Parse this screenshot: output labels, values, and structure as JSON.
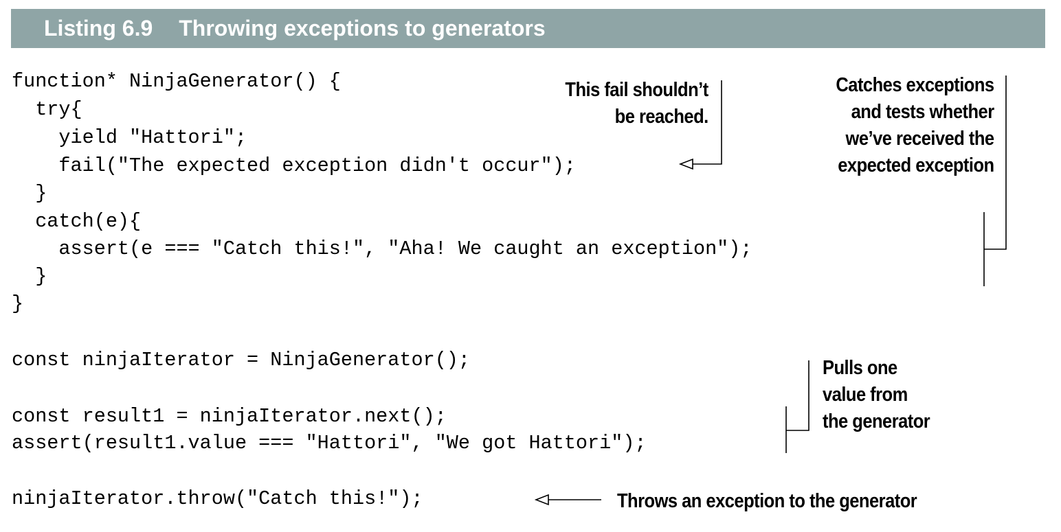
{
  "listing": {
    "number": "Listing 6.9",
    "title": "Throwing exceptions to generators"
  },
  "code_lines": [
    "function* NinjaGenerator() {",
    "  try{",
    "    yield \"Hattori\";",
    "    fail(\"The expected exception didn't occur\");",
    "  }",
    "  catch(e){",
    "    assert(e === \"Catch this!\", \"Aha! We caught an exception\");",
    "  }",
    "}",
    "const ninjaIterator = NinjaGenerator();",
    "const result1 = ninjaIterator.next();",
    "assert(result1.value === \"Hattori\", \"We got Hattori\");",
    "ninjaIterator.throw(\"Catch this!\");"
  ],
  "annotations": {
    "fail_note": [
      "This fail shouldn’t",
      "be reached."
    ],
    "catch_note": [
      "Catches exceptions",
      "and tests whether",
      "we’ve received the",
      "expected exception"
    ],
    "pull_note": [
      "Pulls one",
      "value from",
      "the generator"
    ],
    "throw_note": [
      "Throws an exception to the generator"
    ]
  },
  "colors": {
    "header_background": "#8fa5a6",
    "header_text": "#ffffff",
    "text": "#000000"
  }
}
